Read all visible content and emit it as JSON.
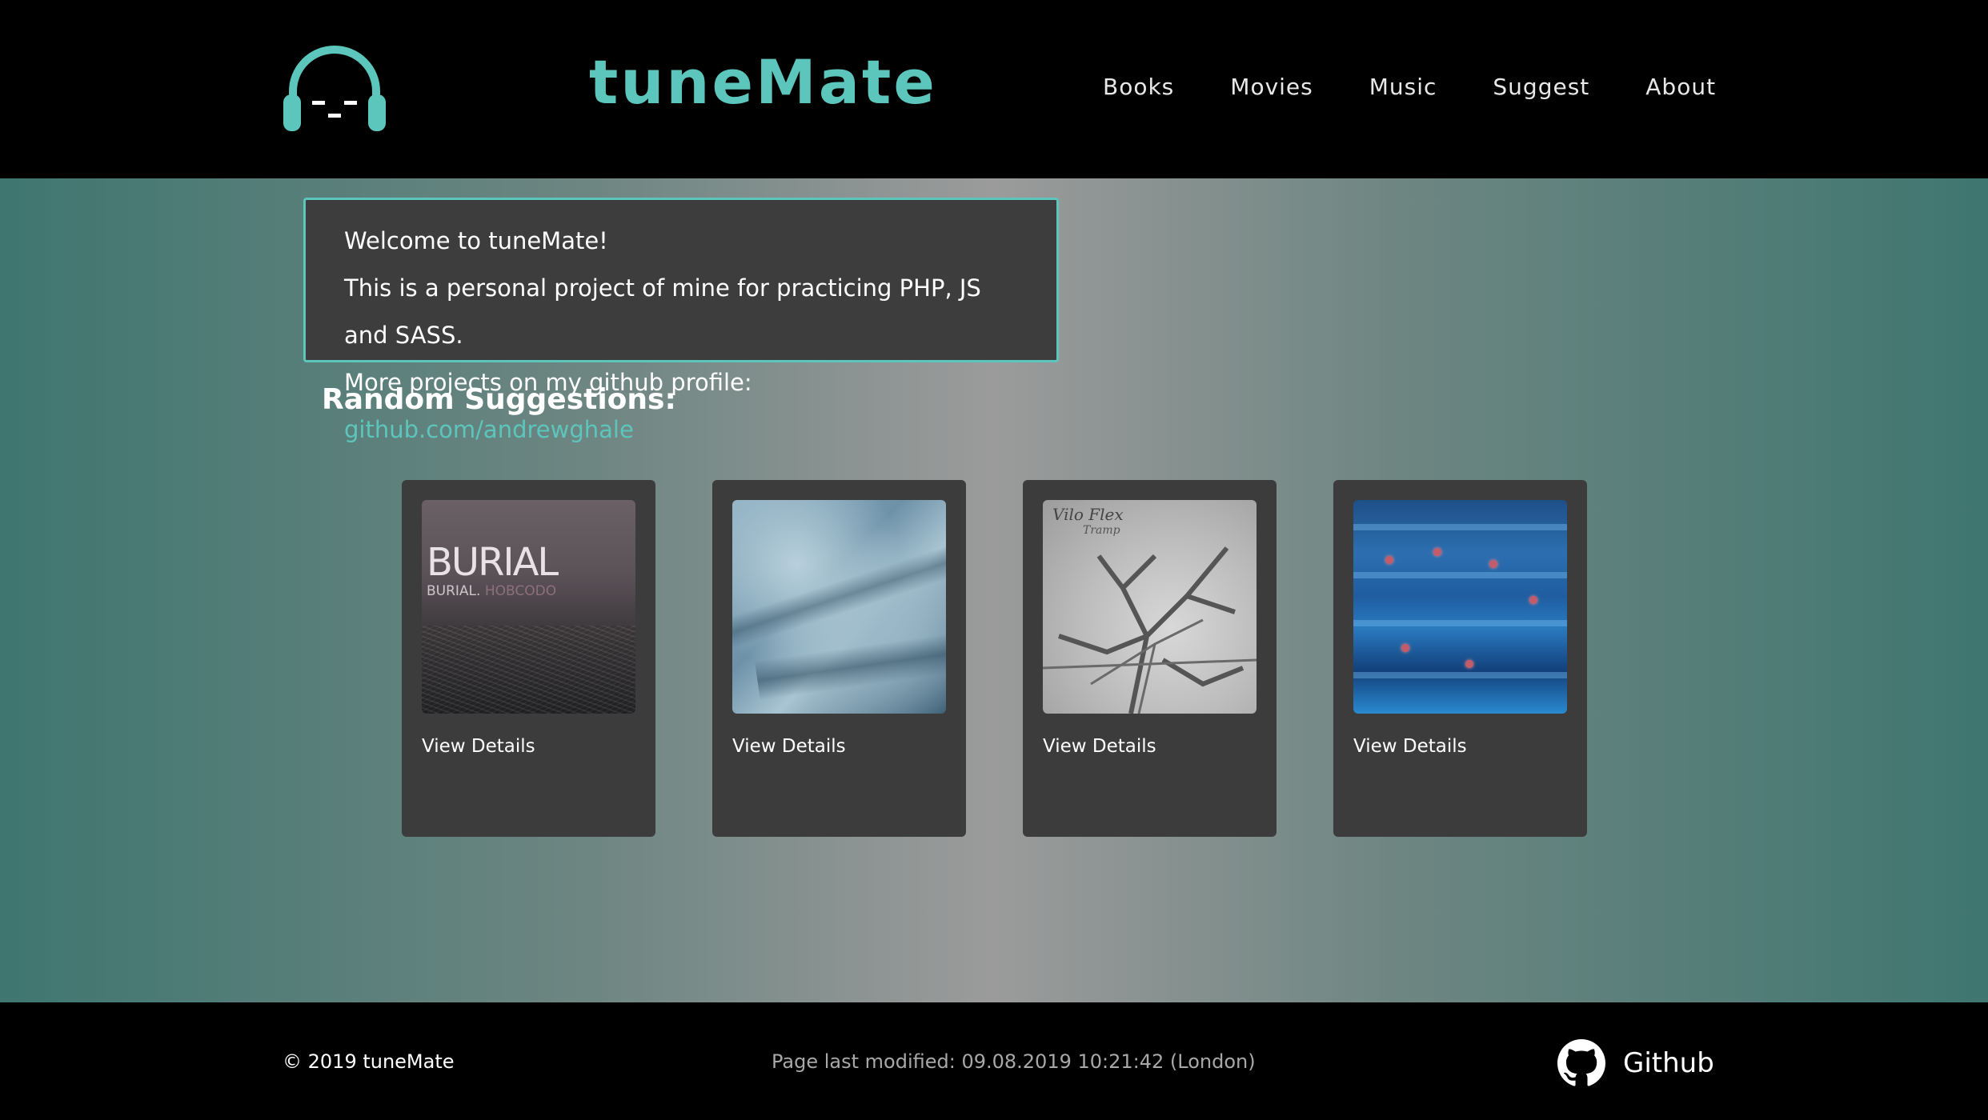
{
  "header": {
    "brand": "tuneMate",
    "nav": [
      "Books",
      "Movies",
      "Music",
      "Suggest",
      "About"
    ]
  },
  "welcome": {
    "line1": "Welcome to tuneMate!",
    "line2": "This is a personal project of mine for practicing PHP, JS and SASS.",
    "line3_prefix": "More projects on my github profile: ",
    "link_text": "github.com/andrewghale"
  },
  "suggestions": {
    "title": "Random Suggestions:",
    "cards": [
      {
        "cover_title": "BURIAL",
        "cover_sub_1": "BURIAL.",
        "cover_sub_2": "HOBCODO",
        "action": "View Details"
      },
      {
        "action": "View Details"
      },
      {
        "cover_title": "Vilo Flex",
        "cover_sub": "Tramp",
        "action": "View Details"
      },
      {
        "action": "View Details"
      }
    ]
  },
  "footer": {
    "copyright": "© 2019 tuneMate",
    "modified": "Page last modified: 09.08.2019 10:21:42 (London)",
    "github_label": "Github"
  },
  "colors": {
    "accent": "#5cc6bc",
    "panel": "#3c3c3c",
    "header_bg": "#000000"
  }
}
